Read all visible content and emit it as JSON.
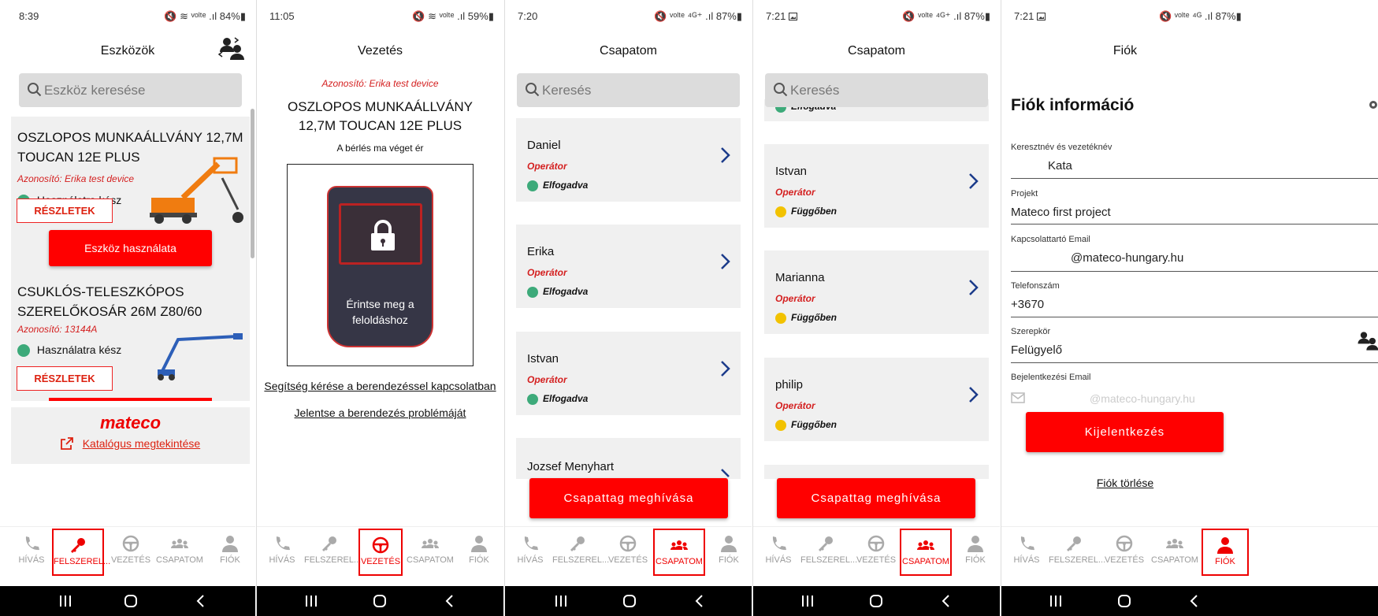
{
  "screens": [
    {
      "status": {
        "time": "8:39",
        "right": "🔇 ≋ ᵛᵒˡᵗᵉ .ıl 84%▮"
      },
      "title": "Eszközök",
      "search_placeholder": "Eszköz keresése",
      "devices": [
        {
          "name": "OSZLOPOS MUNKAÁLLVÁNY 12,7M TOUCAN 12E PLUS",
          "id": "Azonosító: Erika test device",
          "status": "Használatra kész",
          "details": "RÉSZLETEK",
          "use": "Eszköz használata"
        },
        {
          "name": "CSUKLÓS-TELESZKÓPOS SZERELŐKOSÁR 26M Z80/60",
          "id": "Azonosító: 13144A",
          "status": "Használatra kész",
          "details": "RÉSZLETEK"
        }
      ],
      "brand": "mateco",
      "catalog": "Katalógus megtekintése"
    },
    {
      "status": {
        "time": "11:05",
        "right": "🔇 ≋ ᵛᵒˡᵗᵉ .ıl 59%▮"
      },
      "title": "Vezetés",
      "device_id": "Azonosító: Erika test device",
      "device_name": "OSZLOPOS MUNKAÁLLVÁNY 12,7M TOUCAN 12E PLUS",
      "rental": "A bérlés ma véget ér",
      "unlock": "Érintse meg a feloldáshoz",
      "help": "Segítség kérése a berendezéssel kapcsolatban",
      "report": "Jelentse a berendezés problémáját"
    },
    {
      "status": {
        "time": "7:20",
        "right": "🔇 ᵛᵒˡᵗᵉ ⁴ᴳ⁺ .ıl 87%▮"
      },
      "title": "Csapatom",
      "search_placeholder": "Keresés",
      "members": [
        {
          "name": "Daniel",
          "role": "Operátor",
          "state": "Elfogadva"
        },
        {
          "name": "Erika",
          "role": "Operátor",
          "state": "Elfogadva"
        },
        {
          "name": "Istvan",
          "role": "Operátor",
          "state": "Elfogadva"
        },
        {
          "name": "Jozsef Menyhart"
        }
      ],
      "invite": "Csapattag meghívása"
    },
    {
      "status": {
        "time": "7:21",
        "right": "🔇 ᵛᵒˡᵗᵉ ⁴ᴳ⁺ .ıl 87%▮"
      },
      "title": "Csapatom",
      "search_placeholder": "Keresés",
      "partial_state": "Elfogadva",
      "members": [
        {
          "name": "Istvan",
          "role": "Operátor",
          "state": "Függőben"
        },
        {
          "name": "Marianna",
          "role": "Operátor",
          "state": "Függőben"
        },
        {
          "name": "philip",
          "role": "Operátor",
          "state": "Függőben"
        }
      ],
      "invite": "Csapattag meghívása"
    },
    {
      "status": {
        "time": "7:21",
        "right": "🔇 ᵛᵒˡᵗᵉ ⁴ᴳ .ıl 87%▮"
      },
      "title": "Fiók",
      "heading": "Fiók információ",
      "fields": [
        {
          "label": "Keresztnév és vezetéknév",
          "value": "Kata"
        },
        {
          "label": "Projekt",
          "value": "Mateco first project"
        },
        {
          "label": "Kapcsolattartó Email",
          "value": "@mateco-hungary.hu"
        },
        {
          "label": "Telefonszám",
          "value": "+3670"
        },
        {
          "label": "Szerepkör",
          "value": "Felügyelő"
        },
        {
          "label": "Bejelentkezési Email",
          "value": "@mateco-hungary.hu"
        }
      ],
      "logout": "Kijelentkezés",
      "delete": "Fiók törlése"
    }
  ],
  "nav": {
    "hivas": "HÍVÁS",
    "felszereles": "FELSZEREL...",
    "vezetes": "VEZETÉS",
    "csapatom": "CSAPATOM",
    "fiok": "FIÓK"
  },
  "colors": {
    "accent": "#ff0000",
    "ready": "#3daa7a",
    "pending": "#f2c200",
    "chevron": "#1b3b8a"
  }
}
